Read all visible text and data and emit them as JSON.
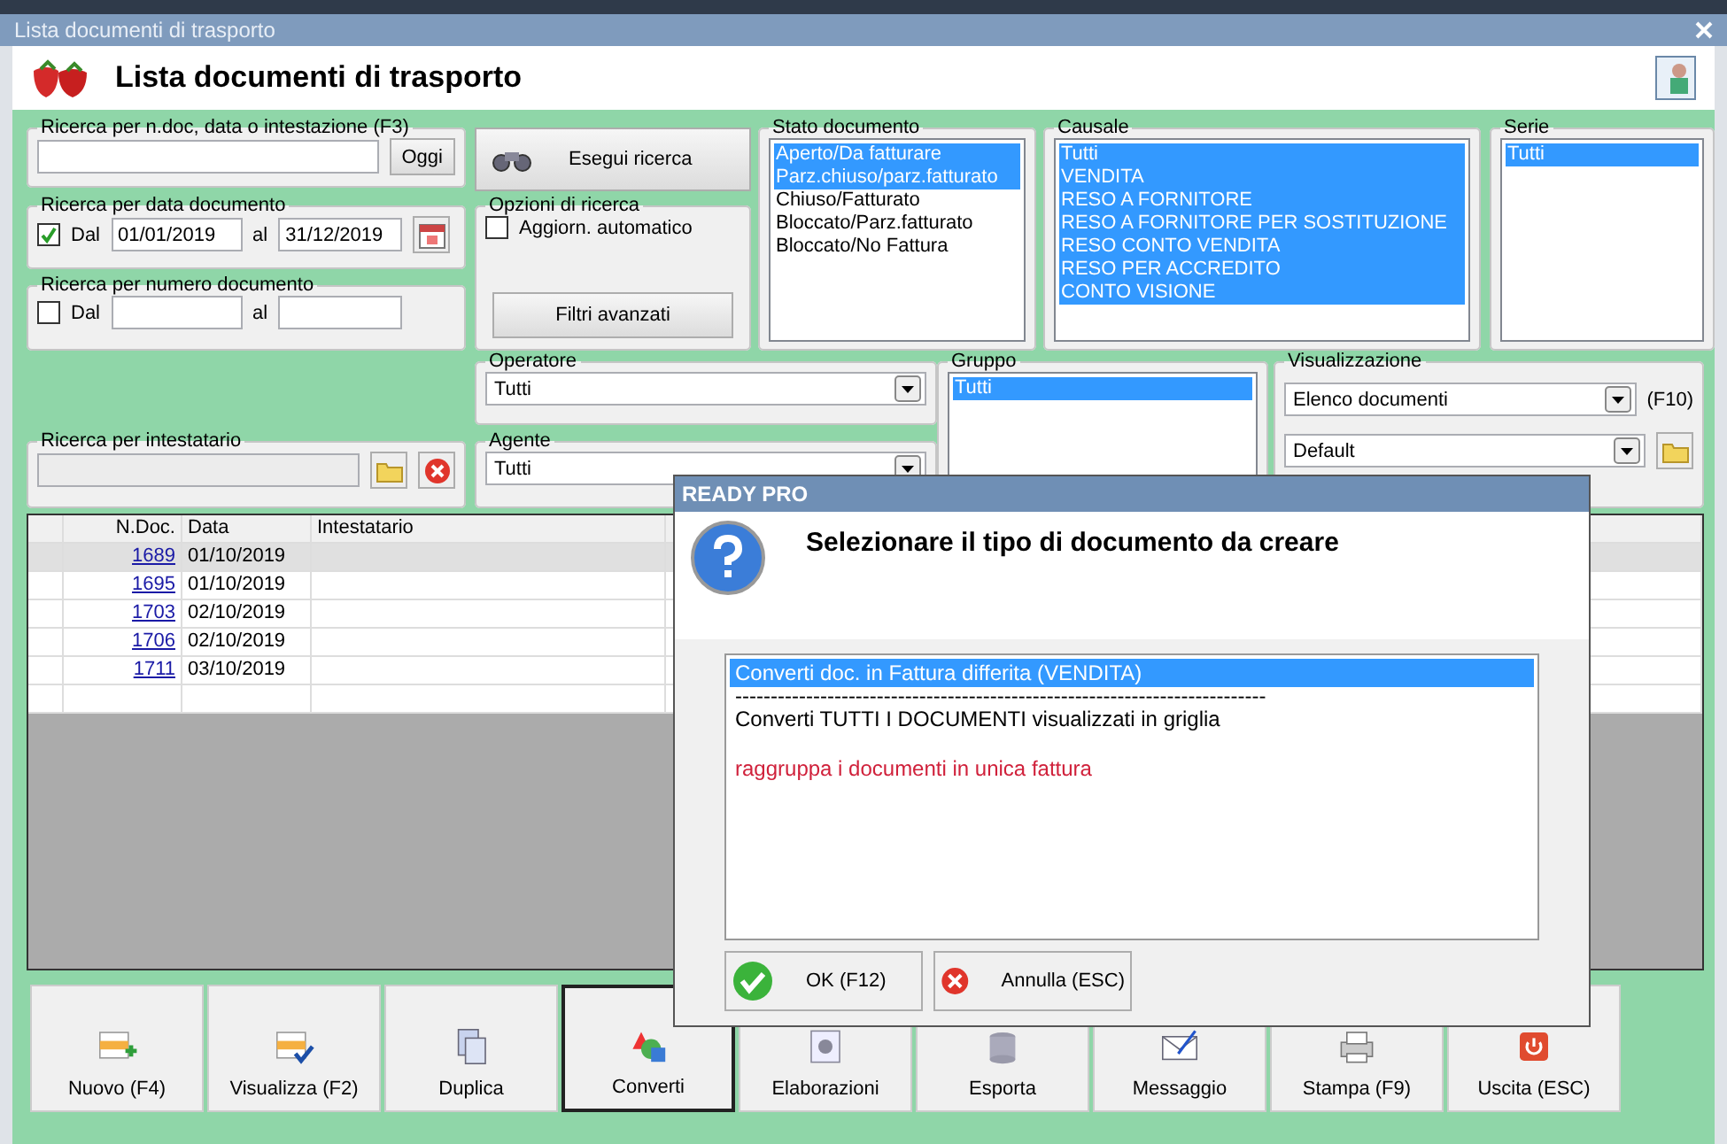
{
  "window": {
    "title": "Lista documenti di trasporto"
  },
  "header": {
    "title": "Lista documenti di trasporto"
  },
  "search": {
    "legend": "Ricerca per n.doc, data o intestazione (F3)",
    "button": "Oggi"
  },
  "date_range": {
    "legend": "Ricerca per data documento",
    "checked": true,
    "from_label": "Dal",
    "from": "01/01/2019",
    "to_label": "al",
    "to": "31/12/2019"
  },
  "number_range": {
    "legend": "Ricerca per numero documento",
    "checked": false,
    "from_label": "Dal",
    "to_label": "al"
  },
  "owner_search": {
    "legend": "Ricerca per intestatario"
  },
  "search_button": "Esegui ricerca",
  "search_options": {
    "legend": "Opzioni di ricerca",
    "auto_update": {
      "label": "Aggiorn. automatico",
      "checked": false
    },
    "advanced_button": "Filtri avanzati"
  },
  "operator": {
    "legend": "Operatore",
    "value": "Tutti"
  },
  "agent": {
    "legend": "Agente",
    "value": "Tutti"
  },
  "status": {
    "legend": "Stato documento",
    "items": [
      {
        "label": "Aperto/Da fatturare",
        "selected": true
      },
      {
        "label": "Parz.chiuso/parz.fatturato",
        "selected": true
      },
      {
        "label": "Chiuso/Fatturato",
        "selected": false
      },
      {
        "label": "Bloccato/Parz.fatturato",
        "selected": false
      },
      {
        "label": "Bloccato/No Fattura",
        "selected": false
      }
    ]
  },
  "causale": {
    "legend": "Causale",
    "items": [
      {
        "label": "Tutti",
        "selected": true
      },
      {
        "label": "VENDITA",
        "selected": true
      },
      {
        "label": "RESO A FORNITORE",
        "selected": true
      },
      {
        "label": "RESO A FORNITORE PER SOSTITUZIONE",
        "selected": true
      },
      {
        "label": "RESO CONTO VENDITA",
        "selected": true
      },
      {
        "label": "RESO PER ACCREDITO",
        "selected": true
      },
      {
        "label": "CONTO VISIONE",
        "selected": true
      }
    ]
  },
  "serie": {
    "legend": "Serie",
    "items": [
      {
        "label": "Tutti",
        "selected": true
      }
    ]
  },
  "gruppo": {
    "legend": "Gruppo",
    "items": [
      {
        "label": "Tutti",
        "selected": true
      }
    ]
  },
  "view": {
    "legend": "Visualizzazione",
    "mode": "Elenco documenti",
    "shortcut": "(F10)",
    "layout": "Default"
  },
  "table": {
    "columns": [
      "N.Doc.",
      "Data",
      "Intestatario"
    ],
    "rows": [
      {
        "n_doc": "1689",
        "date": "01/10/2019",
        "selected": true
      },
      {
        "n_doc": "1695",
        "date": "01/10/2019",
        "selected": false
      },
      {
        "n_doc": "1703",
        "date": "02/10/2019",
        "selected": false
      },
      {
        "n_doc": "1706",
        "date": "02/10/2019",
        "selected": false
      },
      {
        "n_doc": "1711",
        "date": "03/10/2019",
        "selected": false
      }
    ]
  },
  "toolbar": [
    {
      "label": "Nuovo (F4)",
      "kind": "add",
      "focused": false
    },
    {
      "label": "Visualizza (F2)",
      "kind": "view",
      "focused": false
    },
    {
      "label": "Duplica",
      "kind": "copy",
      "focused": false
    },
    {
      "label": "Converti",
      "kind": "convert",
      "focused": true
    },
    {
      "label": "Elaborazioni",
      "kind": "process",
      "focused": false
    },
    {
      "label": "Esporta",
      "kind": "export",
      "focused": false
    },
    {
      "label": "Messaggio",
      "kind": "message",
      "focused": false
    },
    {
      "label": "Stampa (F9)",
      "kind": "print",
      "focused": false
    },
    {
      "label": "Uscita (ESC)",
      "kind": "exit",
      "focused": false
    }
  ],
  "dialog": {
    "title": "READY PRO",
    "message": "Selezionare il tipo di documento da creare",
    "options": [
      {
        "kind": "item",
        "text": "Converti doc. in Fattura differita (VENDITA)",
        "selected": true
      },
      {
        "kind": "separator",
        "text": "---------------------------------------------------------------------------",
        "selected": false
      },
      {
        "kind": "item",
        "text": "Converti TUTTI I DOCUMENTI visualizzati in griglia",
        "selected": false
      },
      {
        "kind": "note",
        "text": "raggruppa i documenti in unica fattura",
        "selected": false
      }
    ],
    "buttons": [
      {
        "label": "OK (F12)",
        "kind": "ok"
      },
      {
        "label": "Annulla (ESC)",
        "kind": "cancel"
      }
    ]
  }
}
